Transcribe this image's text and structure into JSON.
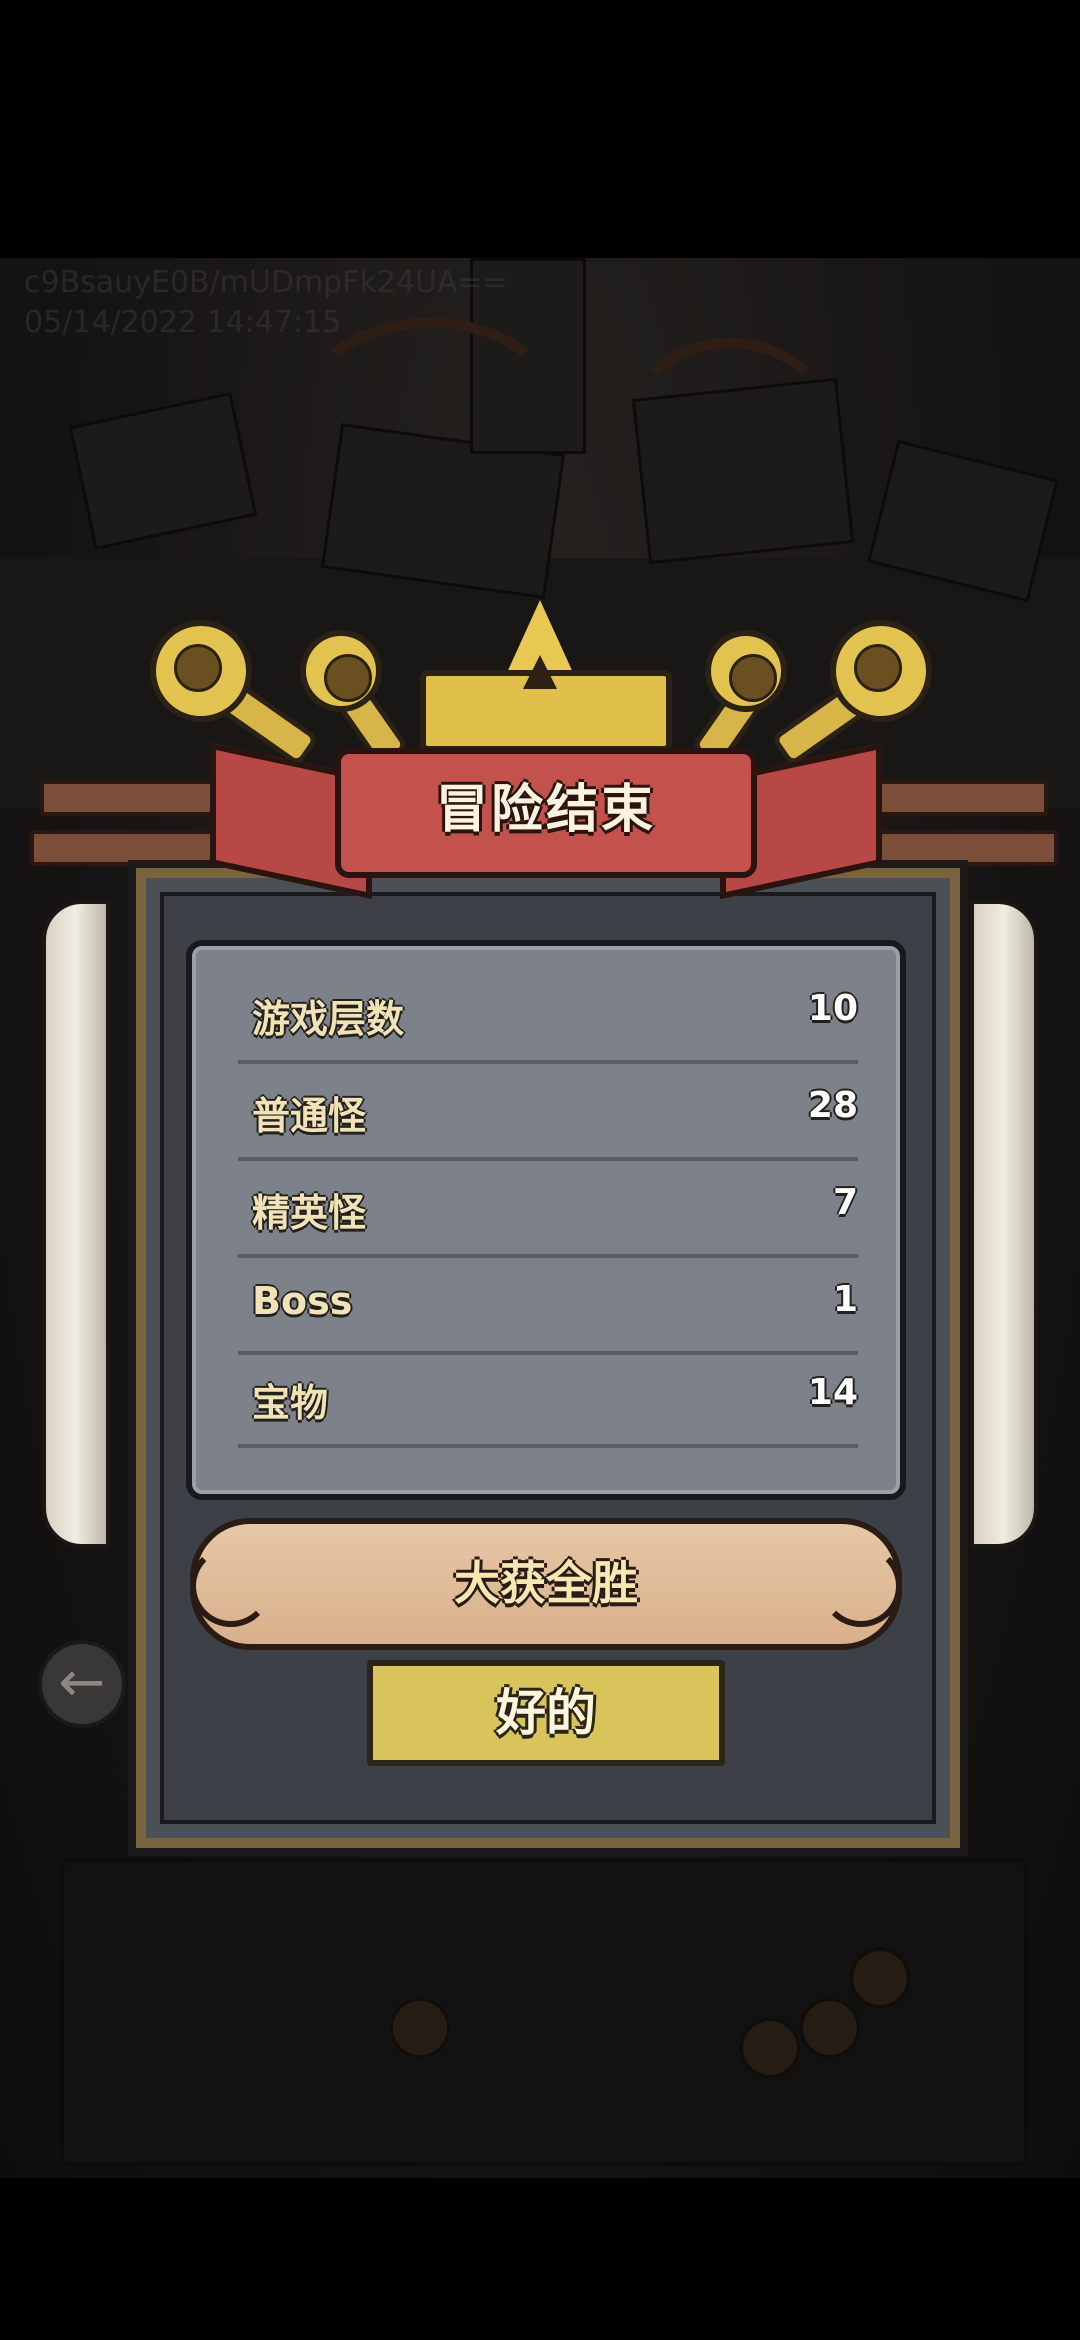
{
  "watermark": {
    "id": "c9BsauyE0B/mUDmpFk24UA==",
    "datetime": "05/14/2022 14:47:15"
  },
  "dialog": {
    "title": "冒险结束",
    "stats": [
      {
        "label": "游戏层数",
        "value": "10"
      },
      {
        "label": "普通怪",
        "value": "28"
      },
      {
        "label": "精英怪",
        "value": "7"
      },
      {
        "label": "Boss",
        "value": "1"
      },
      {
        "label": "宝物",
        "value": "14"
      }
    ],
    "result": "大获全胜",
    "ok_label": "好的"
  },
  "icons": {
    "back": "arrow-left-icon",
    "crown": "crown-icon",
    "horn": "horn-icon"
  },
  "colors": {
    "ribbon": "#c3514c",
    "ok_button": "#d8c45a",
    "panel": "#7c818a"
  }
}
